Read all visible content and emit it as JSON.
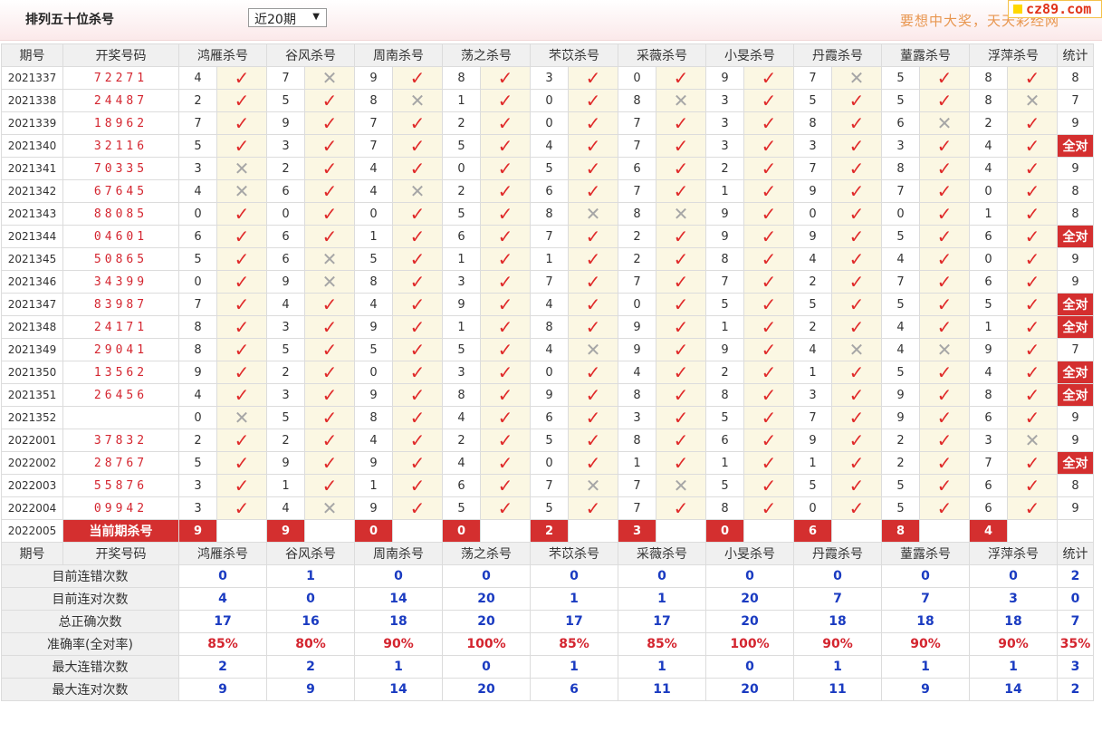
{
  "header": {
    "title": "排列五十位杀号",
    "select_value": "近20期",
    "promo": "要想中大奖，天天彩经网",
    "logo": "cz89.com"
  },
  "columns": [
    "期号",
    "开奖号码",
    "鸿雁杀号",
    "谷风杀号",
    "周南杀号",
    "荡之杀号",
    "芣苡杀号",
    "采薇杀号",
    "小旻杀号",
    "丹霞杀号",
    "蕫露杀号",
    "浮萍杀号",
    "统计"
  ],
  "rows": [
    {
      "period": "2021337",
      "numbers": "72271",
      "picks": [
        [
          4,
          1
        ],
        [
          7,
          0
        ],
        [
          9,
          1
        ],
        [
          8,
          1
        ],
        [
          3,
          1
        ],
        [
          0,
          1
        ],
        [
          9,
          1
        ],
        [
          7,
          0
        ],
        [
          5,
          1
        ],
        [
          8,
          1
        ]
      ],
      "stat": "8"
    },
    {
      "period": "2021338",
      "numbers": "24487",
      "picks": [
        [
          2,
          1
        ],
        [
          5,
          1
        ],
        [
          8,
          0
        ],
        [
          1,
          1
        ],
        [
          0,
          1
        ],
        [
          8,
          0
        ],
        [
          3,
          1
        ],
        [
          5,
          1
        ],
        [
          5,
          1
        ],
        [
          8,
          0
        ]
      ],
      "stat": "7"
    },
    {
      "period": "2021339",
      "numbers": "18962",
      "picks": [
        [
          7,
          1
        ],
        [
          9,
          1
        ],
        [
          7,
          1
        ],
        [
          2,
          1
        ],
        [
          0,
          1
        ],
        [
          7,
          1
        ],
        [
          3,
          1
        ],
        [
          8,
          1
        ],
        [
          6,
          0
        ],
        [
          2,
          1
        ]
      ],
      "stat": "9"
    },
    {
      "period": "2021340",
      "numbers": "32116",
      "picks": [
        [
          5,
          1
        ],
        [
          3,
          1
        ],
        [
          7,
          1
        ],
        [
          5,
          1
        ],
        [
          4,
          1
        ],
        [
          7,
          1
        ],
        [
          3,
          1
        ],
        [
          3,
          1
        ],
        [
          3,
          1
        ],
        [
          4,
          1
        ]
      ],
      "stat": "全对"
    },
    {
      "period": "2021341",
      "numbers": "70335",
      "picks": [
        [
          3,
          0
        ],
        [
          2,
          1
        ],
        [
          4,
          1
        ],
        [
          0,
          1
        ],
        [
          5,
          1
        ],
        [
          6,
          1
        ],
        [
          2,
          1
        ],
        [
          7,
          1
        ],
        [
          8,
          1
        ],
        [
          4,
          1
        ]
      ],
      "stat": "9"
    },
    {
      "period": "2021342",
      "numbers": "67645",
      "picks": [
        [
          4,
          0
        ],
        [
          6,
          1
        ],
        [
          4,
          0
        ],
        [
          2,
          1
        ],
        [
          6,
          1
        ],
        [
          7,
          1
        ],
        [
          1,
          1
        ],
        [
          9,
          1
        ],
        [
          7,
          1
        ],
        [
          0,
          1
        ]
      ],
      "stat": "8"
    },
    {
      "period": "2021343",
      "numbers": "88085",
      "picks": [
        [
          0,
          1
        ],
        [
          0,
          1
        ],
        [
          0,
          1
        ],
        [
          5,
          1
        ],
        [
          8,
          0
        ],
        [
          8,
          0
        ],
        [
          9,
          1
        ],
        [
          0,
          1
        ],
        [
          0,
          1
        ],
        [
          1,
          1
        ]
      ],
      "stat": "8"
    },
    {
      "period": "2021344",
      "numbers": "04601",
      "picks": [
        [
          6,
          1
        ],
        [
          6,
          1
        ],
        [
          1,
          1
        ],
        [
          6,
          1
        ],
        [
          7,
          1
        ],
        [
          2,
          1
        ],
        [
          9,
          1
        ],
        [
          9,
          1
        ],
        [
          5,
          1
        ],
        [
          6,
          1
        ]
      ],
      "stat": "全对"
    },
    {
      "period": "2021345",
      "numbers": "50865",
      "picks": [
        [
          5,
          1
        ],
        [
          6,
          0
        ],
        [
          5,
          1
        ],
        [
          1,
          1
        ],
        [
          1,
          1
        ],
        [
          2,
          1
        ],
        [
          8,
          1
        ],
        [
          4,
          1
        ],
        [
          4,
          1
        ],
        [
          0,
          1
        ]
      ],
      "stat": "9"
    },
    {
      "period": "2021346",
      "numbers": "34399",
      "picks": [
        [
          0,
          1
        ],
        [
          9,
          0
        ],
        [
          8,
          1
        ],
        [
          3,
          1
        ],
        [
          7,
          1
        ],
        [
          7,
          1
        ],
        [
          7,
          1
        ],
        [
          2,
          1
        ],
        [
          7,
          1
        ],
        [
          6,
          1
        ]
      ],
      "stat": "9"
    },
    {
      "period": "2021347",
      "numbers": "83987",
      "picks": [
        [
          7,
          1
        ],
        [
          4,
          1
        ],
        [
          4,
          1
        ],
        [
          9,
          1
        ],
        [
          4,
          1
        ],
        [
          0,
          1
        ],
        [
          5,
          1
        ],
        [
          5,
          1
        ],
        [
          5,
          1
        ],
        [
          5,
          1
        ]
      ],
      "stat": "全对"
    },
    {
      "period": "2021348",
      "numbers": "24171",
      "picks": [
        [
          8,
          1
        ],
        [
          3,
          1
        ],
        [
          9,
          1
        ],
        [
          1,
          1
        ],
        [
          8,
          1
        ],
        [
          9,
          1
        ],
        [
          1,
          1
        ],
        [
          2,
          1
        ],
        [
          4,
          1
        ],
        [
          1,
          1
        ]
      ],
      "stat": "全对"
    },
    {
      "period": "2021349",
      "numbers": "29041",
      "picks": [
        [
          8,
          1
        ],
        [
          5,
          1
        ],
        [
          5,
          1
        ],
        [
          5,
          1
        ],
        [
          4,
          0
        ],
        [
          9,
          1
        ],
        [
          9,
          1
        ],
        [
          4,
          0
        ],
        [
          4,
          0
        ],
        [
          9,
          1
        ]
      ],
      "stat": "7"
    },
    {
      "period": "2021350",
      "numbers": "13562",
      "picks": [
        [
          9,
          1
        ],
        [
          2,
          1
        ],
        [
          0,
          1
        ],
        [
          3,
          1
        ],
        [
          0,
          1
        ],
        [
          4,
          1
        ],
        [
          2,
          1
        ],
        [
          1,
          1
        ],
        [
          5,
          1
        ],
        [
          4,
          1
        ]
      ],
      "stat": "全对"
    },
    {
      "period": "2021351",
      "numbers": "26456",
      "picks": [
        [
          4,
          1
        ],
        [
          3,
          1
        ],
        [
          9,
          1
        ],
        [
          8,
          1
        ],
        [
          9,
          1
        ],
        [
          8,
          1
        ],
        [
          8,
          1
        ],
        [
          3,
          1
        ],
        [
          9,
          1
        ],
        [
          8,
          1
        ]
      ],
      "stat": "全对"
    },
    {
      "period": "2021352",
      "numbers": "",
      "picks": [
        [
          0,
          0
        ],
        [
          5,
          1
        ],
        [
          8,
          1
        ],
        [
          4,
          1
        ],
        [
          6,
          1
        ],
        [
          3,
          1
        ],
        [
          5,
          1
        ],
        [
          7,
          1
        ],
        [
          9,
          1
        ],
        [
          6,
          1
        ]
      ],
      "stat": "9"
    },
    {
      "period": "2022001",
      "numbers": "37832",
      "picks": [
        [
          2,
          1
        ],
        [
          2,
          1
        ],
        [
          4,
          1
        ],
        [
          2,
          1
        ],
        [
          5,
          1
        ],
        [
          8,
          1
        ],
        [
          6,
          1
        ],
        [
          9,
          1
        ],
        [
          2,
          1
        ],
        [
          3,
          0
        ]
      ],
      "stat": "9"
    },
    {
      "period": "2022002",
      "numbers": "28767",
      "picks": [
        [
          5,
          1
        ],
        [
          9,
          1
        ],
        [
          9,
          1
        ],
        [
          4,
          1
        ],
        [
          0,
          1
        ],
        [
          1,
          1
        ],
        [
          1,
          1
        ],
        [
          1,
          1
        ],
        [
          2,
          1
        ],
        [
          7,
          1
        ]
      ],
      "stat": "全对"
    },
    {
      "period": "2022003",
      "numbers": "55876",
      "picks": [
        [
          3,
          1
        ],
        [
          1,
          1
        ],
        [
          1,
          1
        ],
        [
          6,
          1
        ],
        [
          7,
          0
        ],
        [
          7,
          0
        ],
        [
          5,
          1
        ],
        [
          5,
          1
        ],
        [
          5,
          1
        ],
        [
          6,
          1
        ]
      ],
      "stat": "8"
    },
    {
      "period": "2022004",
      "numbers": "09942",
      "picks": [
        [
          3,
          1
        ],
        [
          4,
          0
        ],
        [
          9,
          1
        ],
        [
          5,
          1
        ],
        [
          5,
          1
        ],
        [
          7,
          1
        ],
        [
          8,
          1
        ],
        [
          0,
          1
        ],
        [
          5,
          1
        ],
        [
          6,
          1
        ]
      ],
      "stat": "9"
    }
  ],
  "current": {
    "period": "2022005",
    "label": "当前期杀号",
    "kills": [
      9,
      9,
      0,
      0,
      2,
      3,
      0,
      6,
      8,
      4
    ]
  },
  "summary": [
    {
      "label": "目前连错次数",
      "values": [
        "0",
        "1",
        "0",
        "0",
        "0",
        "0",
        "0",
        "0",
        "0",
        "0",
        "2"
      ],
      "kind": "sval"
    },
    {
      "label": "目前连对次数",
      "values": [
        "4",
        "0",
        "14",
        "20",
        "1",
        "1",
        "20",
        "7",
        "7",
        "3",
        "0"
      ],
      "kind": "sval"
    },
    {
      "label": "总正确次数",
      "values": [
        "17",
        "16",
        "18",
        "20",
        "17",
        "17",
        "20",
        "18",
        "18",
        "18",
        "7"
      ],
      "kind": "sval"
    },
    {
      "label": "准确率(全对率)",
      "values": [
        "85%",
        "80%",
        "90%",
        "100%",
        "85%",
        "85%",
        "100%",
        "90%",
        "90%",
        "90%",
        "35%"
      ],
      "kind": "rate"
    },
    {
      "label": "最大连错次数",
      "values": [
        "2",
        "2",
        "1",
        "0",
        "1",
        "1",
        "0",
        "1",
        "1",
        "1",
        "3"
      ],
      "kind": "sval"
    },
    {
      "label": "最大连对次数",
      "values": [
        "9",
        "9",
        "14",
        "20",
        "6",
        "11",
        "20",
        "11",
        "9",
        "14",
        "2"
      ],
      "kind": "sval"
    }
  ],
  "icons": {
    "correct": "check-icon",
    "wrong": "cross-icon"
  },
  "colors": {
    "accent_red": "#d42f2f",
    "value_blue": "#1a3bc1",
    "check_red": "#e02a2a",
    "cross_gray": "#a6a6a6"
  }
}
